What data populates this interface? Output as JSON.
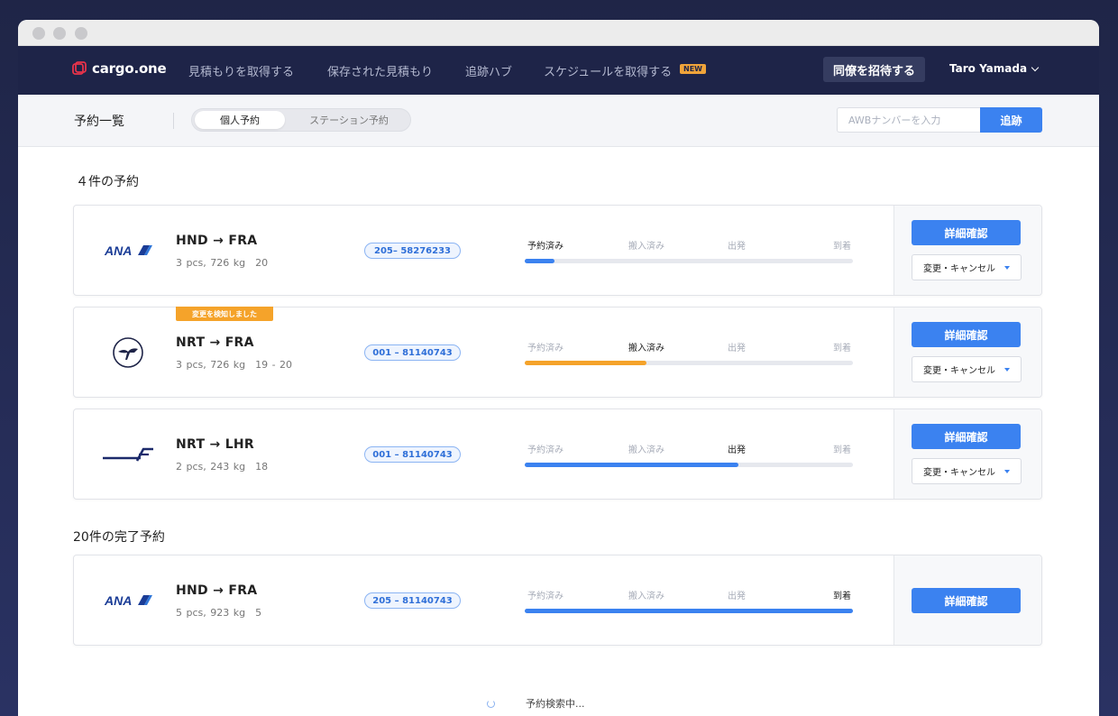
{
  "nav": {
    "logo": "cargo.one",
    "items": [
      "見積もりを取得する",
      "保存された見積もり",
      "追跡ハブ",
      "スケジュールを取得する"
    ],
    "new_badge": "NEW",
    "invite": "同僚を招待する",
    "user": "Taro Yamada"
  },
  "sub": {
    "title": "予約一覧",
    "tab_personal": "個人予約",
    "tab_station": "ステーション予約",
    "awb_placeholder": "AWBナンバーを入力",
    "track": "追跡"
  },
  "active_title": "４件の予約",
  "completed_title": "20件の完了予約",
  "step_labels": [
    "予約済み",
    "搬入済み",
    "出発",
    "到着"
  ],
  "detail_label": "詳細確認",
  "change_label": "変更・キャンセル",
  "change_detected": "変更を検知しました",
  "bookings": [
    {
      "airline": "ANA",
      "route": "HND → FRA",
      "meta": "3 pcs, 726 kg　20",
      "awb": "205– 58276233",
      "step": 0,
      "progress": 0.09,
      "color": "#3b82f0"
    },
    {
      "airline": "Lufthansa",
      "route": "NRT → FRA",
      "meta": "3 pcs, 726 kg　19 - 20",
      "awb": "001 – 81140743",
      "step": 1,
      "progress": 0.37,
      "color": "#f5a32a"
    },
    {
      "airline": "Finnair",
      "route": "NRT →  LHR",
      "meta": "2 pcs, 243 kg　18",
      "awb": "001 – 81140743",
      "step": 2,
      "progress": 0.65,
      "color": "#3b82f0"
    },
    {
      "airline": "ANA",
      "route": "HND → FRA",
      "meta": "5 pcs, 923 kg　5",
      "awb": "205 – 81140743",
      "step": 3,
      "progress": 1.0,
      "color": "#3b82f0"
    }
  ],
  "loading": "予約検索中..."
}
